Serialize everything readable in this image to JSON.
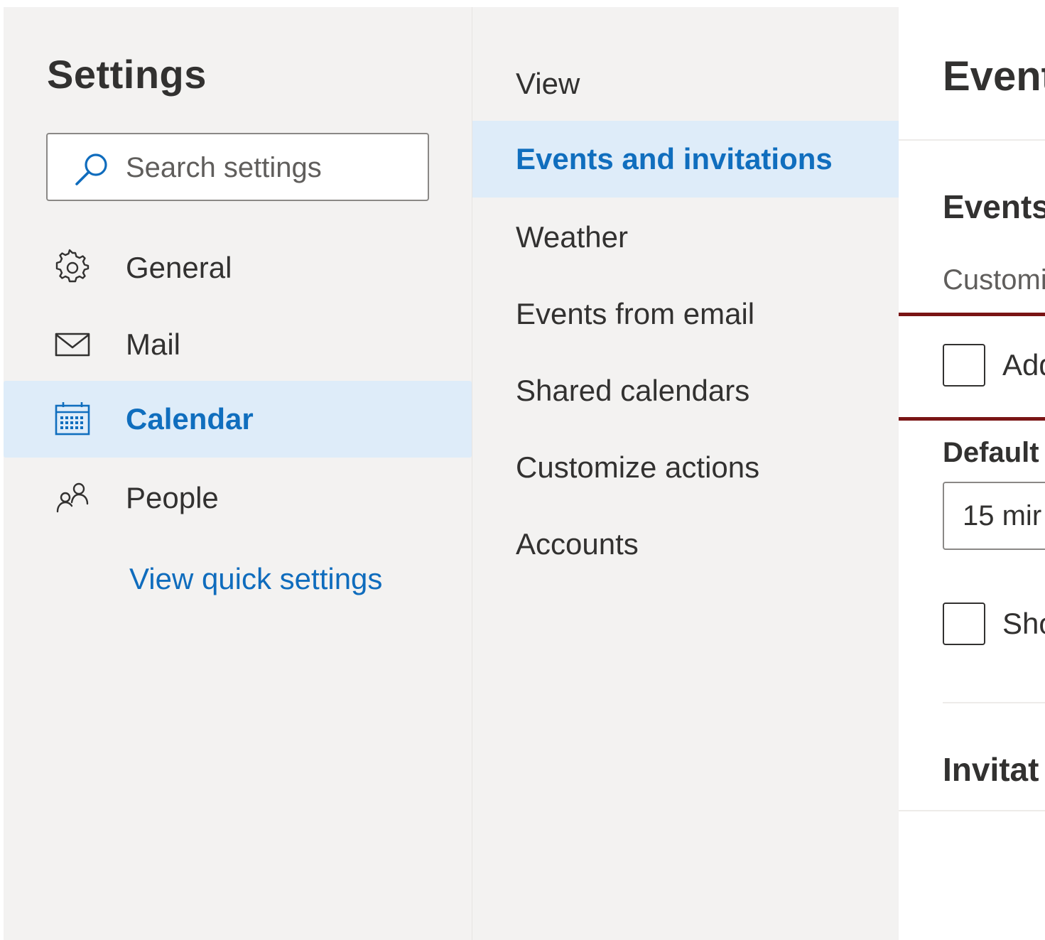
{
  "nav": {
    "title": "Settings",
    "search_placeholder": "Search settings",
    "items": [
      {
        "label": "General",
        "icon": "gear-icon"
      },
      {
        "label": "Mail",
        "icon": "mail-icon"
      },
      {
        "label": "Calendar",
        "icon": "calendar-icon",
        "selected": true
      },
      {
        "label": "People",
        "icon": "people-icon"
      }
    ],
    "quick_settings_link": "View quick settings"
  },
  "subnav": {
    "items": [
      {
        "label": "View"
      },
      {
        "label": "Events and invitations",
        "selected": true
      },
      {
        "label": "Weather"
      },
      {
        "label": "Events from email"
      },
      {
        "label": "Shared calendars"
      },
      {
        "label": "Customize actions"
      },
      {
        "label": "Accounts"
      }
    ]
  },
  "content": {
    "title": "Event",
    "events_section": "Events",
    "description": "Customi",
    "checkbox_1_label": "Add",
    "default_label": "Default",
    "default_value": "15 mir",
    "checkbox_2_label": "Sho",
    "invitations_section": "Invitat"
  },
  "colors": {
    "accent": "#106ebe",
    "selected_bg": "#deecf9",
    "pane_bg": "#f3f2f1",
    "highlight_border": "#7a1515"
  }
}
